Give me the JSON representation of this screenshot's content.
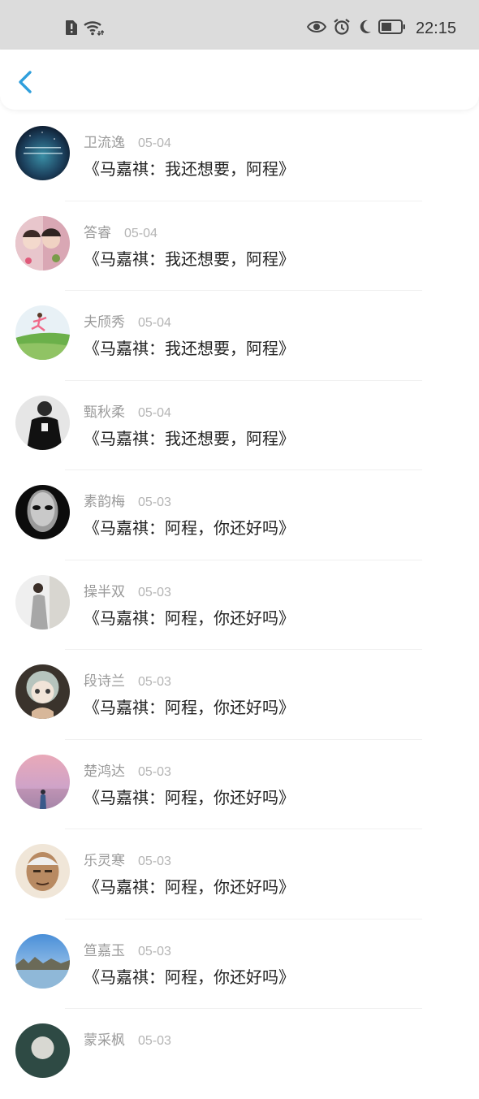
{
  "status_bar": {
    "time": "22:15",
    "icons": [
      "sim-alert-icon",
      "wifi-icon",
      "eye-icon",
      "alarm-icon",
      "moon-icon",
      "battery-icon"
    ]
  },
  "nav": {
    "back_icon": "chevron-left-icon",
    "accent": "#2f9fdc"
  },
  "items": [
    {
      "name": "卫流逸",
      "date": "05-04",
      "title": "《马嘉祺：我还想要，阿程》",
      "avatar": "night-sky-text"
    },
    {
      "name": "答睿",
      "date": "05-04",
      "title": "《马嘉祺：我还想要，阿程》",
      "avatar": "couple-selfie"
    },
    {
      "name": "夫颀秀",
      "date": "05-04",
      "title": "《马嘉祺：我还想要，阿程》",
      "avatar": "runner-grass"
    },
    {
      "name": "甄秋柔",
      "date": "05-04",
      "title": "《马嘉祺：我还想要，阿程》",
      "avatar": "person-dark-tshirt"
    },
    {
      "name": "素韵梅",
      "date": "05-03",
      "title": "《马嘉祺：阿程，你还好吗》",
      "avatar": "white-mask"
    },
    {
      "name": "操半双",
      "date": "05-03",
      "title": "《马嘉祺：阿程，你还好吗》",
      "avatar": "person-wall"
    },
    {
      "name": "段诗兰",
      "date": "05-03",
      "title": "《马嘉祺：阿程，你还好吗》",
      "avatar": "doll"
    },
    {
      "name": "楚鸿达",
      "date": "05-03",
      "title": "《马嘉祺：阿程，你还好吗》",
      "avatar": "pink-sky-person"
    },
    {
      "name": "乐灵寒",
      "date": "05-03",
      "title": "《马嘉祺：阿程，你还好吗》",
      "avatar": "old-man"
    },
    {
      "name": "笪嘉玉",
      "date": "05-03",
      "title": "《马嘉祺：阿程，你还好吗》",
      "avatar": "lake-trees"
    },
    {
      "name": "蒙采枫",
      "date": "05-03",
      "title": "",
      "avatar": "partial"
    }
  ]
}
